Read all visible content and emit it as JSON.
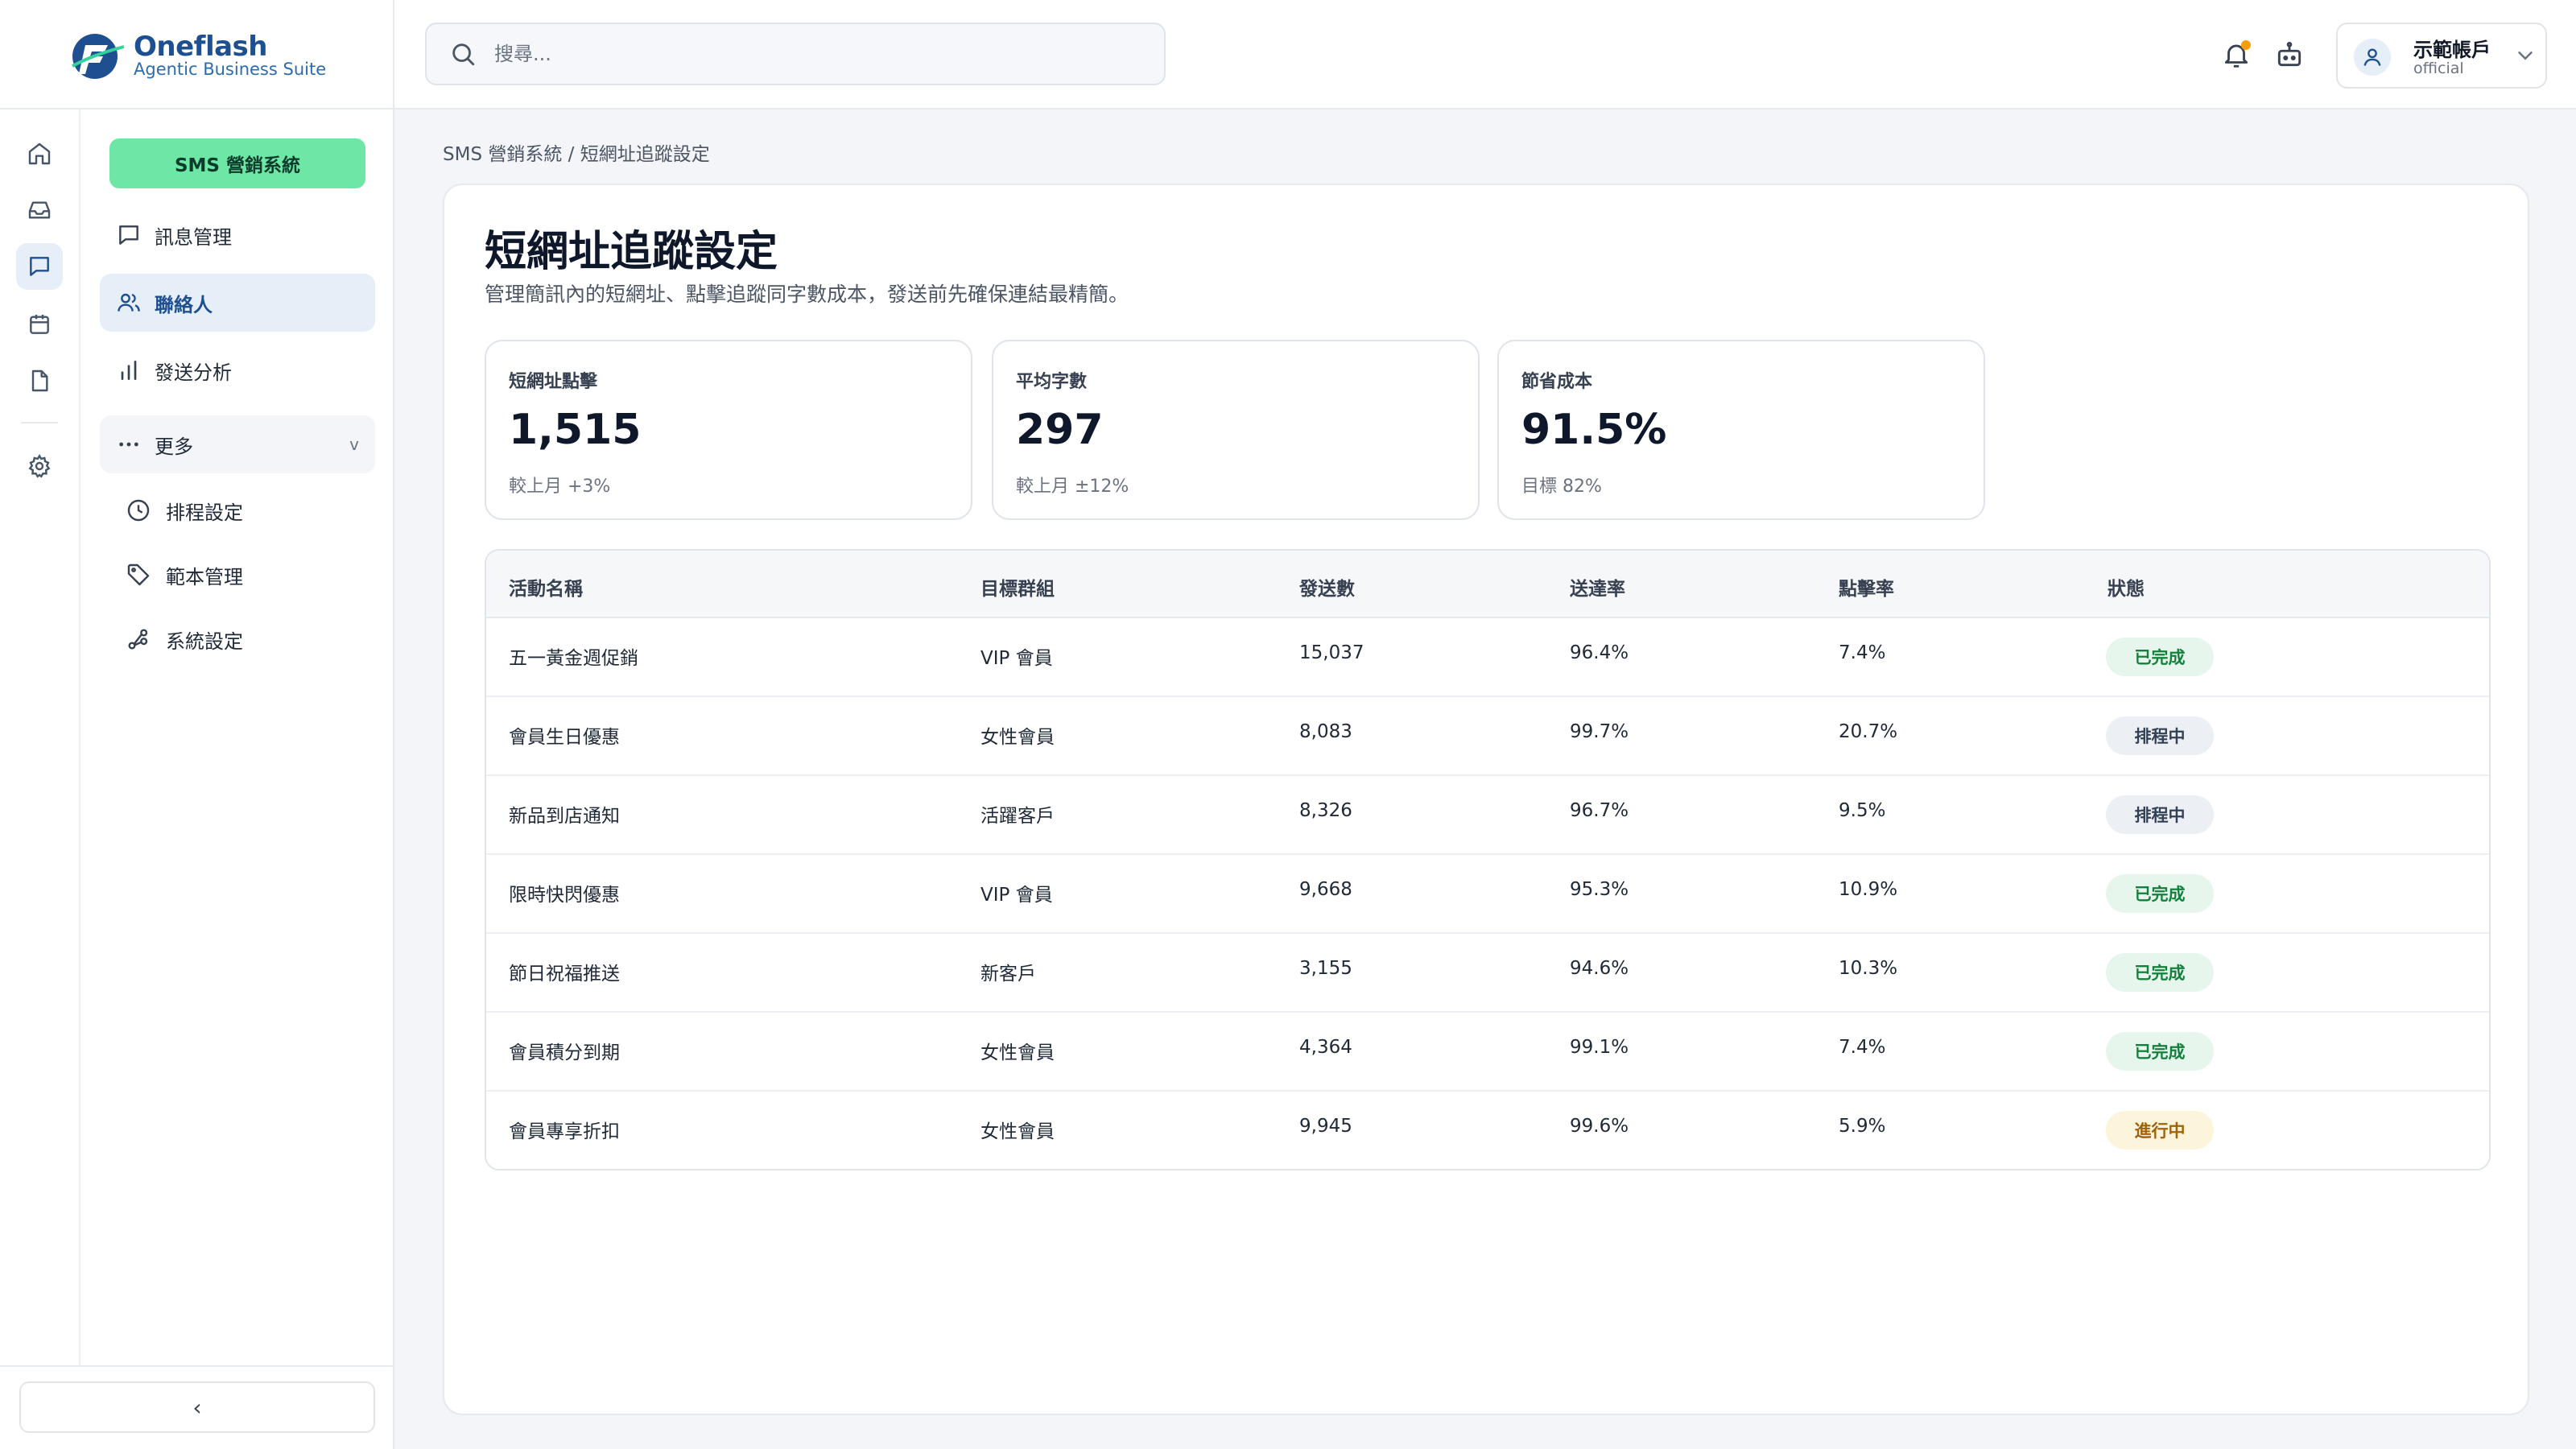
{
  "brand": {
    "name": "Oneflash",
    "tagline": "Agentic Business Suite"
  },
  "search": {
    "placeholder": "搜尋..."
  },
  "account": {
    "name": "示範帳戶",
    "role": "official"
  },
  "sidebar": {
    "header": "SMS 營銷系統",
    "items": [
      {
        "label": "訊息管理",
        "icon": "message-square-icon"
      },
      {
        "label": "聯絡人",
        "icon": "users-icon",
        "active": true
      },
      {
        "label": "發送分析",
        "icon": "bar-chart-icon"
      }
    ],
    "more": {
      "label": "更多",
      "caret": "v"
    },
    "sub_items": [
      {
        "label": "排程設定",
        "icon": "clock-icon"
      },
      {
        "label": "範本管理",
        "icon": "tag-icon"
      },
      {
        "label": "系統設定",
        "icon": "git-branch-icon"
      }
    ],
    "collapse": "‹"
  },
  "breadcrumb": "SMS 營銷系統 / 短網址追蹤設定",
  "page": {
    "title": "短網址追蹤設定",
    "description": "管理簡訊內的短網址、點擊追蹤同字數成本，發送前先確保連結最精簡。"
  },
  "stats": [
    {
      "label": "短網址點擊",
      "value": "1,515",
      "sub": "較上月 +3%"
    },
    {
      "label": "平均字數",
      "value": "297",
      "sub": "較上月 ±12%"
    },
    {
      "label": "節省成本",
      "value": "91.5%",
      "sub": "目標 82%"
    }
  ],
  "table": {
    "headers": [
      "活動名稱",
      "目標群組",
      "發送數",
      "送達率",
      "點擊率",
      "狀態"
    ],
    "rows": [
      {
        "name": "五一黃金週促銷",
        "group": "VIP 會員",
        "sent": "15,037",
        "delivery": "96.4%",
        "ctr": "7.4%",
        "status": "已完成",
        "status_type": "done"
      },
      {
        "name": "會員生日優惠",
        "group": "女性會員",
        "sent": "8,083",
        "delivery": "99.7%",
        "ctr": "20.7%",
        "status": "排程中",
        "status_type": "sched"
      },
      {
        "name": "新品到店通知",
        "group": "活躍客戶",
        "sent": "8,326",
        "delivery": "96.7%",
        "ctr": "9.5%",
        "status": "排程中",
        "status_type": "sched"
      },
      {
        "name": "限時快閃優惠",
        "group": "VIP 會員",
        "sent": "9,668",
        "delivery": "95.3%",
        "ctr": "10.9%",
        "status": "已完成",
        "status_type": "done"
      },
      {
        "name": "節日祝福推送",
        "group": "新客戶",
        "sent": "3,155",
        "delivery": "94.6%",
        "ctr": "10.3%",
        "status": "已完成",
        "status_type": "done"
      },
      {
        "name": "會員積分到期",
        "group": "女性會員",
        "sent": "4,364",
        "delivery": "99.1%",
        "ctr": "7.4%",
        "status": "已完成",
        "status_type": "done"
      },
      {
        "name": "會員專享折扣",
        "group": "女性會員",
        "sent": "9,945",
        "delivery": "99.6%",
        "ctr": "5.9%",
        "status": "進行中",
        "status_type": "run"
      }
    ]
  },
  "colors": {
    "brand_blue": "#1d4f91",
    "accent_green": "#6ee7a6",
    "done": "#15803d",
    "scheduled": "#334155",
    "running": "#a16207"
  }
}
